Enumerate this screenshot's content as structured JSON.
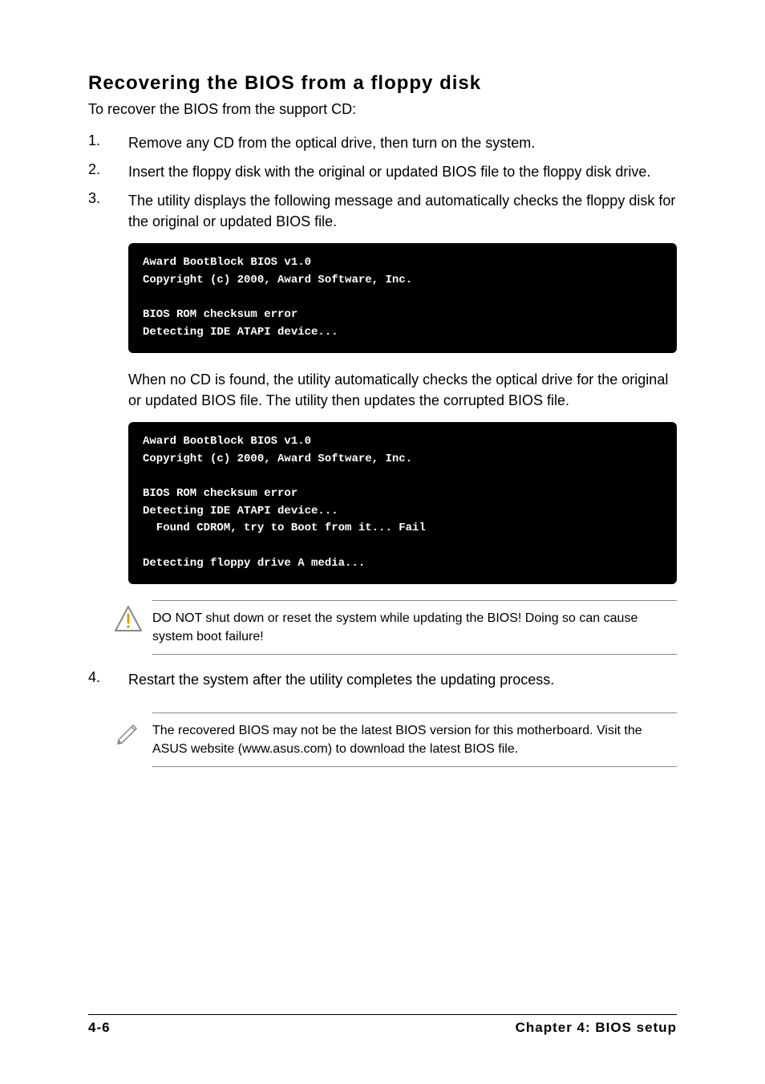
{
  "heading": "Recovering the BIOS from a floppy disk",
  "intro": "To recover the BIOS from the support CD:",
  "steps": {
    "s1": {
      "num": "1.",
      "text": "Remove any CD from the optical drive, then turn on the system."
    },
    "s2": {
      "num": "2.",
      "text": "Insert the floppy disk with the original or updated BIOS file to the floppy disk drive."
    },
    "s3": {
      "num": "3.",
      "text": "The utility displays the following message and automatically checks the floppy disk for the original or updated BIOS file."
    },
    "s4": {
      "num": "4.",
      "text": "Restart the system after the utility completes the updating process."
    }
  },
  "code1": "Award BootBlock BIOS v1.0\nCopyright (c) 2000, Award Software, Inc.\n\nBIOS ROM checksum error\nDetecting IDE ATAPI device...",
  "para_after_code1": "When no CD is found, the utility automatically checks the optical drive for the original or updated BIOS file. The utility then updates the corrupted BIOS file.",
  "code2": "Award BootBlock BIOS v1.0\nCopyright (c) 2000, Award Software, Inc.\n\nBIOS ROM checksum error\nDetecting IDE ATAPI device...\n  Found CDROM, try to Boot from it... Fail\n\nDetecting floppy drive A media...",
  "callout_warning": "DO NOT shut down or reset the system while updating the BIOS! Doing so can cause system boot failure!",
  "callout_note": "The recovered BIOS may not be the latest BIOS version for this motherboard. Visit the ASUS website (www.asus.com) to download the latest BIOS file.",
  "footer_left": "4-6",
  "footer_right": "Chapter 4: BIOS setup"
}
